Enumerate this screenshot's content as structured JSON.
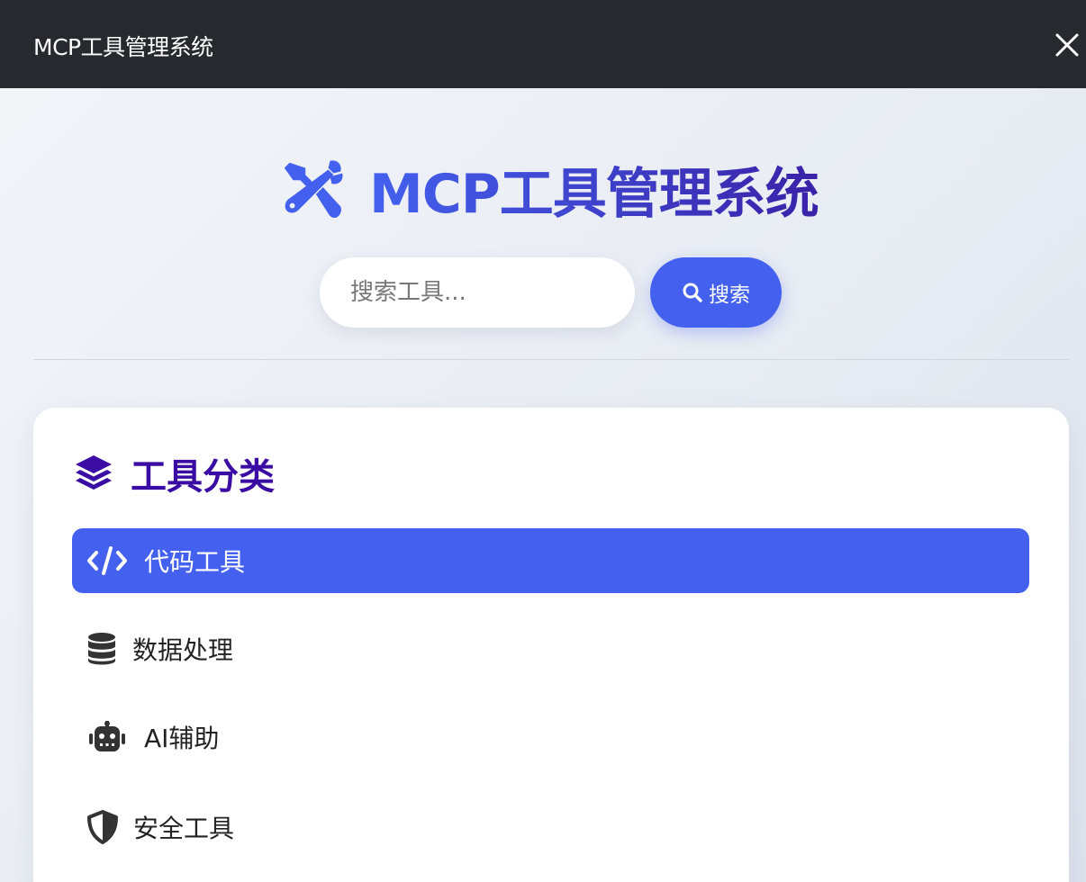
{
  "window": {
    "title": "MCP工具管理系统",
    "close_icon": "close-icon"
  },
  "header": {
    "title": "MCP工具管理系统",
    "icon": "tools-icon"
  },
  "search": {
    "placeholder": "搜索工具...",
    "value": "",
    "button_label": "搜索",
    "icon": "search-icon"
  },
  "categories": {
    "heading": "工具分类",
    "heading_icon": "layers-icon",
    "items": [
      {
        "label": "代码工具",
        "icon": "code-icon",
        "active": true
      },
      {
        "label": "数据处理",
        "icon": "database-icon",
        "active": false
      },
      {
        "label": "AI辅助",
        "icon": "robot-icon",
        "active": false
      },
      {
        "label": "安全工具",
        "icon": "shield-icon",
        "active": false
      }
    ]
  },
  "colors": {
    "primary": "#4361ee",
    "secondary": "#3a0ca3",
    "titlebar": "#27292e",
    "text": "#222222"
  }
}
